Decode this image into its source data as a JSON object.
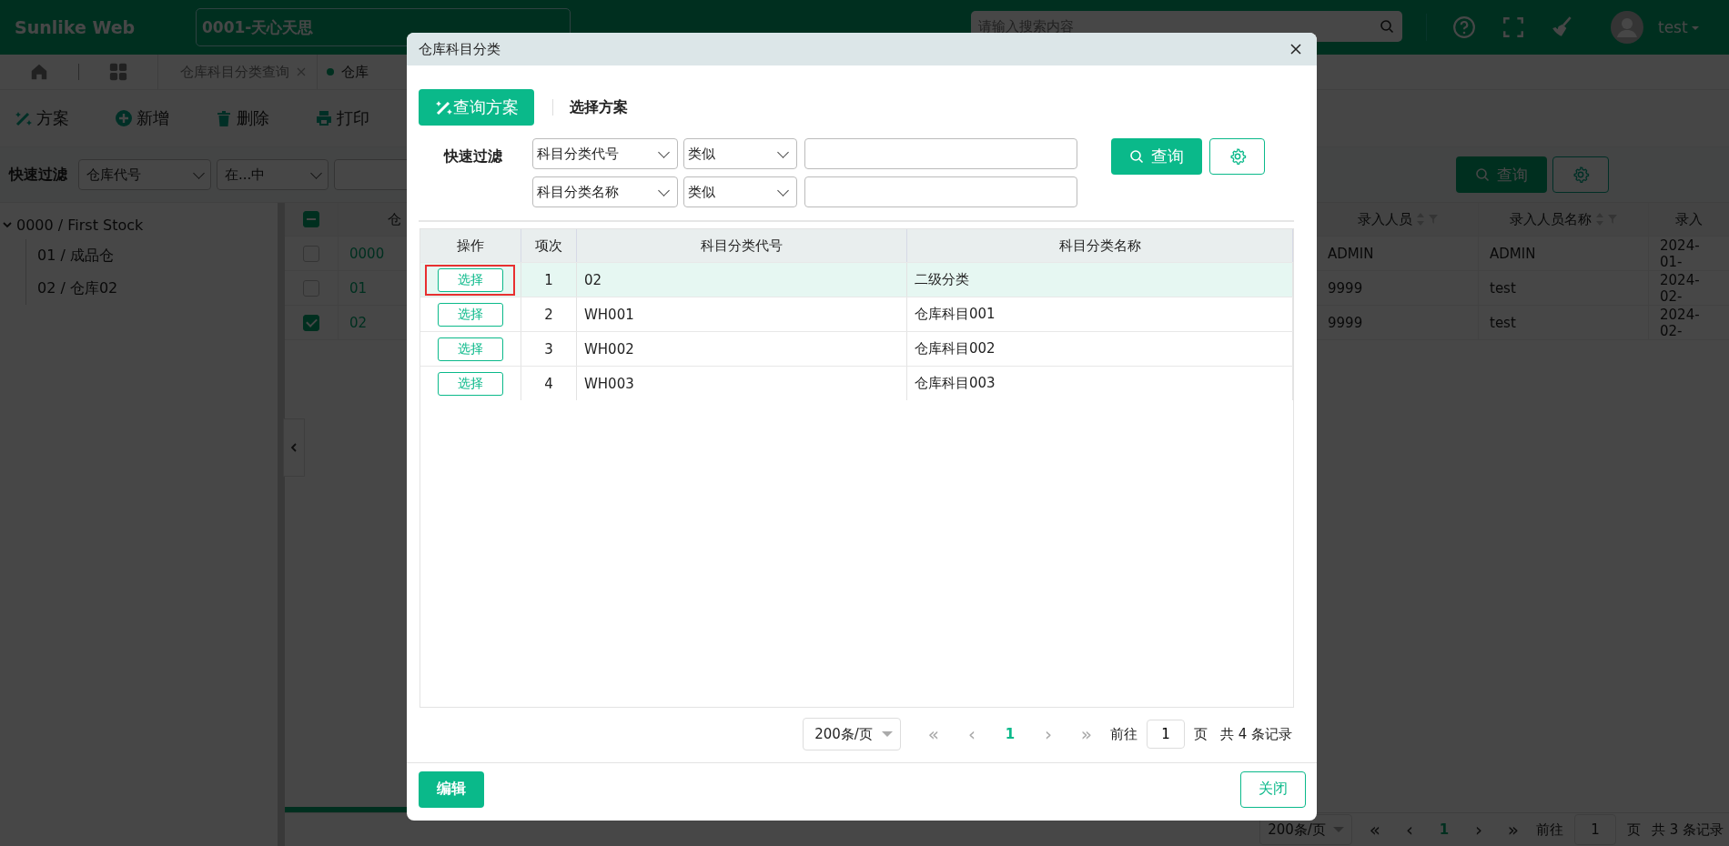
{
  "topbar": {
    "logo": "Sunlike Web",
    "company": "0001-天心天思",
    "search_placeholder": "请输入搜索内容",
    "user": "test"
  },
  "tabs": [
    {
      "label": "仓库科目分类查询",
      "closable": true,
      "selected": false
    },
    {
      "label": "仓库",
      "closable": false,
      "selected": true
    }
  ],
  "toolbar": [
    {
      "kind": "scheme",
      "label": "方案"
    },
    {
      "kind": "add",
      "label": "新增"
    },
    {
      "kind": "delete",
      "label": "删除"
    },
    {
      "kind": "print",
      "label": "打印"
    }
  ],
  "filter": {
    "label": "快速过滤",
    "field": "仓库代号",
    "operator": "在...中",
    "query_button": "查询"
  },
  "tree": [
    {
      "label": "0000 / First Stock",
      "expanded": true,
      "children": [
        {
          "label": "01 / 成品仓"
        },
        {
          "label": "02 / 仓库02"
        }
      ]
    }
  ],
  "grid": {
    "header_checked": true,
    "header_indeterminate": true,
    "column_2": "仓",
    "columns": [
      "录入人员",
      "录入人员名称",
      "录入"
    ],
    "rows": [
      {
        "checked": false,
        "code": "0000",
        "cells": [
          "ADMIN",
          "ADMIN",
          "2024-01-"
        ]
      },
      {
        "checked": false,
        "code": "01",
        "cells": [
          "9999",
          "test",
          "2024-02-"
        ]
      },
      {
        "checked": true,
        "code": "02",
        "cells": [
          "9999",
          "test",
          "2024-02-"
        ]
      }
    ],
    "pagination": {
      "page_size": "200条/页",
      "first": "«",
      "previous": "‹",
      "page": "1",
      "next": "›",
      "last": "»",
      "goto_label": "前往",
      "goto_value": "1",
      "page_unit": "页",
      "total": "共 3 条记录"
    }
  },
  "dialog": {
    "title": "仓库科目分类",
    "scheme_button": "查询方案",
    "choose_scheme": "选择方案",
    "filter_label": "快速过滤",
    "filters": [
      {
        "field": "科目分类代号",
        "operator": "类似"
      },
      {
        "field": "科目分类名称",
        "operator": "类似"
      }
    ],
    "query_button": "查询",
    "columns": [
      "操作",
      "项次",
      "科目分类代号",
      "科目分类名称"
    ],
    "rows": [
      {
        "action": "选择",
        "index": "1",
        "code": "02",
        "name": "二级分类",
        "selected": true,
        "highlighted": true
      },
      {
        "action": "选择",
        "index": "2",
        "code": "WH001",
        "name": "仓库科目001",
        "selected": false,
        "highlighted": false
      },
      {
        "action": "选择",
        "index": "3",
        "code": "WH002",
        "name": "仓库科目002",
        "selected": false,
        "highlighted": false
      },
      {
        "action": "选择",
        "index": "4",
        "code": "WH003",
        "name": "仓库科目003",
        "selected": false,
        "highlighted": false
      }
    ],
    "pagination": {
      "page_size": "200条/页",
      "first": "«",
      "previous": "‹",
      "page": "1",
      "next": "›",
      "last": "»",
      "goto_label": "前往",
      "goto_value": "1",
      "page_unit": "页",
      "total": "共 4 条记录"
    },
    "edit_button": "编辑",
    "close_button": "关闭"
  }
}
